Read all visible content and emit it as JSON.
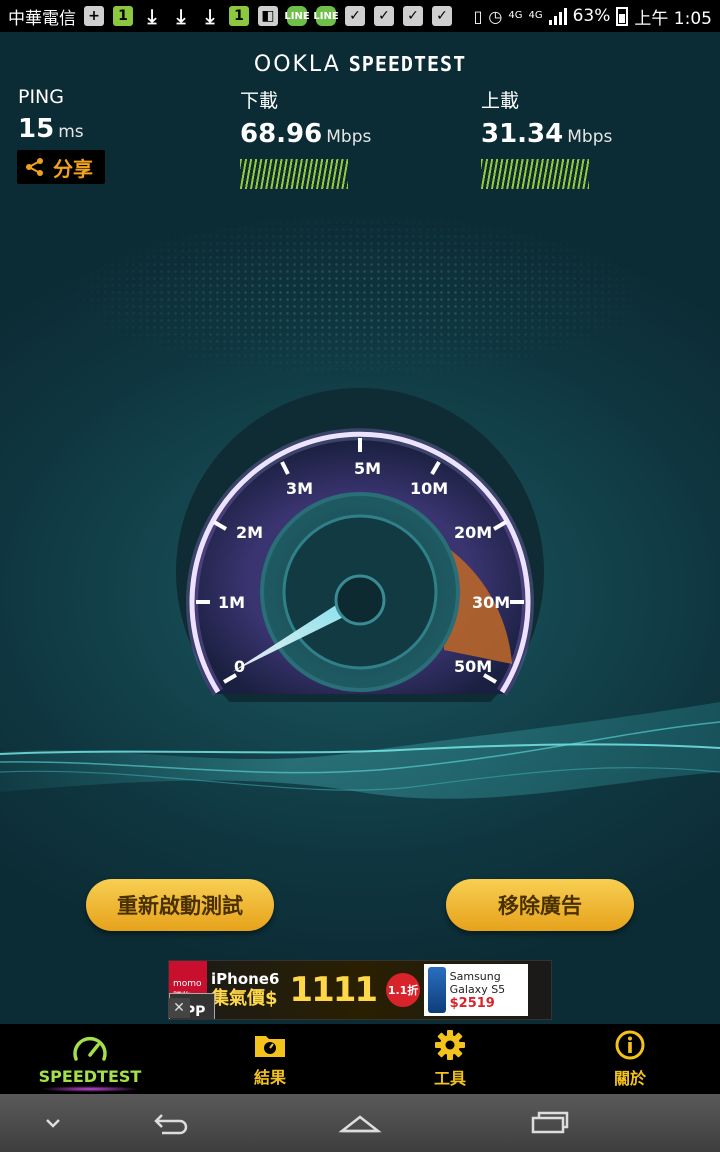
{
  "status_bar": {
    "carrier": "中華電信",
    "battery": "63%",
    "time": "上午 1:05",
    "network": "4G"
  },
  "header": {
    "brand_ookla": "OOKLA",
    "brand_speedtest": "SPEEDTEST"
  },
  "ping": {
    "label": "PING",
    "value": "15",
    "unit": "ms"
  },
  "download": {
    "label": "下載",
    "value": "68.96",
    "unit": "Mbps"
  },
  "upload": {
    "label": "上載",
    "value": "31.34",
    "unit": "Mbps"
  },
  "share_label": "分享",
  "gauge": {
    "ticks": [
      "0",
      "1M",
      "2M",
      "3M",
      "5M",
      "10M",
      "20M",
      "30M",
      "50M"
    ]
  },
  "buttons": {
    "restart": "重新啟動測試",
    "remove_ads": "移除廣告"
  },
  "ad": {
    "brand": "momo購物",
    "line1": "iPhone6",
    "line2": "集氣價$",
    "price": "1111",
    "app": "APP 搶購",
    "discount": "1.1折",
    "phone_name": "Samsung Galaxy S5",
    "phone_price": "$2519",
    "close": "✕"
  },
  "tabs": [
    {
      "label": "SPEEDTEST",
      "icon": "speedometer-icon",
      "active": true
    },
    {
      "label": "結果",
      "icon": "results-folder-icon",
      "active": false
    },
    {
      "label": "工具",
      "icon": "gear-icon",
      "active": false
    },
    {
      "label": "關於",
      "icon": "info-icon",
      "active": false
    }
  ],
  "colors": {
    "accent_gold": "#f3c21d",
    "accent_green": "#a3e04a",
    "button_gold": "#f0b83a",
    "gauge_orange": "#e07a2a"
  }
}
